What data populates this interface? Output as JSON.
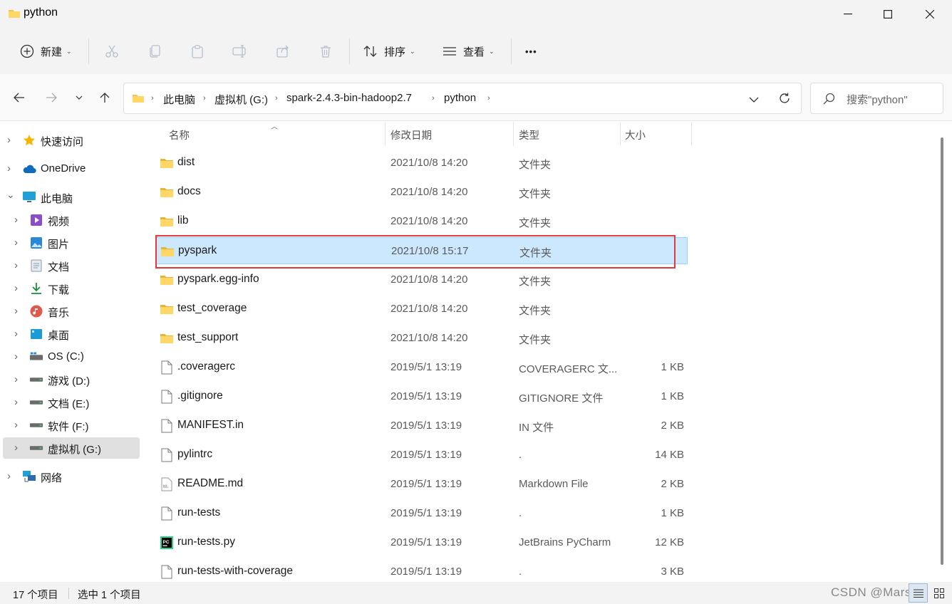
{
  "window": {
    "title": "python"
  },
  "toolbar": {
    "new_label": "新建",
    "sort_label": "排序",
    "view_label": "查看",
    "more_label": "•••"
  },
  "address": {
    "crumbs": [
      "此电脑",
      "虚拟机 (G:)",
      "spark-2.4.3-bin-hadoop2.7",
      "python"
    ],
    "search_placeholder": "搜索\"python\""
  },
  "sidebar": {
    "items": [
      {
        "label": "快速访问",
        "icon": "star-icon"
      },
      {
        "label": "OneDrive",
        "icon": "cloud-icon"
      },
      {
        "label": "此电脑",
        "icon": "monitor-icon"
      },
      {
        "label": "视频",
        "icon": "video-icon"
      },
      {
        "label": "图片",
        "icon": "pictures-icon"
      },
      {
        "label": "文档",
        "icon": "documents-icon"
      },
      {
        "label": "下载",
        "icon": "download-icon"
      },
      {
        "label": "音乐",
        "icon": "music-icon"
      },
      {
        "label": "桌面",
        "icon": "desktop-icon"
      },
      {
        "label": "OS (C:)",
        "icon": "windows-drive-icon"
      },
      {
        "label": "游戏  (D:)",
        "icon": "drive-icon"
      },
      {
        "label": "文档 (E:)",
        "icon": "drive-icon"
      },
      {
        "label": "软件 (F:)",
        "icon": "drive-icon"
      },
      {
        "label": "虚拟机 (G:)",
        "icon": "drive-icon"
      },
      {
        "label": "网络",
        "icon": "network-icon"
      }
    ]
  },
  "columns": {
    "name": "名称",
    "date": "修改日期",
    "type": "类型",
    "size": "大小"
  },
  "files": [
    {
      "name": "dist",
      "date": "2021/10/8 14:20",
      "type": "文件夹",
      "size": "",
      "kind": "folder"
    },
    {
      "name": "docs",
      "date": "2021/10/8 14:20",
      "type": "文件夹",
      "size": "",
      "kind": "folder"
    },
    {
      "name": "lib",
      "date": "2021/10/8 14:20",
      "type": "文件夹",
      "size": "",
      "kind": "folder"
    },
    {
      "name": "pyspark",
      "date": "2021/10/8 15:17",
      "type": "文件夹",
      "size": "",
      "kind": "folder",
      "selected": true
    },
    {
      "name": "pyspark.egg-info",
      "date": "2021/10/8 14:20",
      "type": "文件夹",
      "size": "",
      "kind": "folder"
    },
    {
      "name": "test_coverage",
      "date": "2021/10/8 14:20",
      "type": "文件夹",
      "size": "",
      "kind": "folder"
    },
    {
      "name": "test_support",
      "date": "2021/10/8 14:20",
      "type": "文件夹",
      "size": "",
      "kind": "folder"
    },
    {
      "name": ".coveragerc",
      "date": "2019/5/1 13:19",
      "type": "COVERAGERC 文...",
      "size": "1 KB",
      "kind": "file"
    },
    {
      "name": ".gitignore",
      "date": "2019/5/1 13:19",
      "type": "GITIGNORE 文件",
      "size": "1 KB",
      "kind": "file"
    },
    {
      "name": "MANIFEST.in",
      "date": "2019/5/1 13:19",
      "type": "IN 文件",
      "size": "2 KB",
      "kind": "file"
    },
    {
      "name": "pylintrc",
      "date": "2019/5/1 13:19",
      "type": ".",
      "size": "14 KB",
      "kind": "file"
    },
    {
      "name": "README.md",
      "date": "2019/5/1 13:19",
      "type": "Markdown File",
      "size": "2 KB",
      "kind": "markdown"
    },
    {
      "name": "run-tests",
      "date": "2019/5/1 13:19",
      "type": ".",
      "size": "1 KB",
      "kind": "file"
    },
    {
      "name": "run-tests.py",
      "date": "2019/5/1 13:19",
      "type": "JetBrains PyCharm",
      "size": "12 KB",
      "kind": "pycharm"
    },
    {
      "name": "run-tests-with-coverage",
      "date": "2019/5/1 13:19",
      "type": ".",
      "size": "3 KB",
      "kind": "file"
    }
  ],
  "status": {
    "count": "17 个项目",
    "selected": "选中 1 个项目",
    "watermark": "CSDN @Marsen"
  }
}
